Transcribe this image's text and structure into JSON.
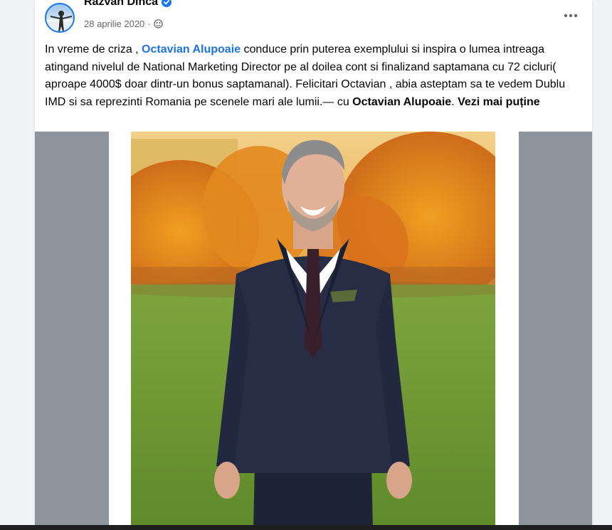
{
  "post": {
    "author": "Razvan Dinca",
    "date": "28 aprilie 2020",
    "separator": "·",
    "more_icon": "more-horizontal-icon",
    "text": {
      "part1": "In vreme de criza , ",
      "mention1": "Octavian Alupoaie",
      "part2": " conduce prin puterea exemplului si inspira o lumea intreaga atingand nivelul de National Marketing Director pe al doilea cont si finalizand saptamana cu 72 cicluri( aproape 4000$ doar dintr-un bonus saptamanal). Felicitari Octavian , abia asteptam sa te vedem Dublu IMD si sa reprezinti Romania pe scenele mari ale lumii.",
      "with_label": "— cu ",
      "mention2": "Octavian Alupoaie",
      "period": ".",
      "see_less": "Vezi mai puține"
    }
  },
  "colors": {
    "link": "#1b74e4",
    "verified": "#1877f2",
    "meta": "#65676b",
    "background": "#f0f2f5"
  }
}
